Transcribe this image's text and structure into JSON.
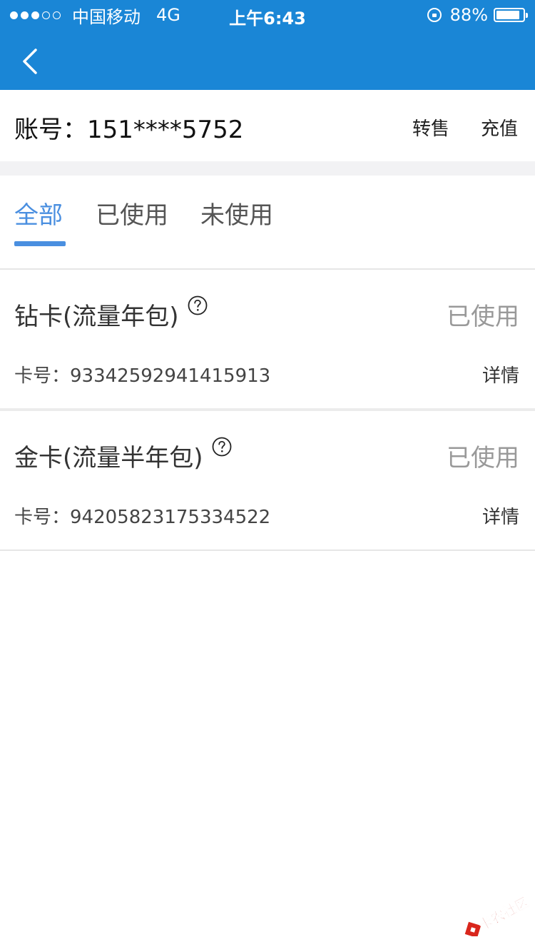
{
  "status_bar": {
    "carrier": "中国移动",
    "network": "4G",
    "time": "上午6:43",
    "battery": "88%",
    "battery_level": 0.88,
    "icons": [
      "signal-dots",
      "orientation-lock-icon",
      "battery-icon"
    ]
  },
  "nav": {
    "back_icon": "chevron-left-icon",
    "bar_color": "#1a86d6"
  },
  "account": {
    "label": "账号：151****5752",
    "transfer": "转售",
    "recharge": "充值"
  },
  "tabs": {
    "items": [
      {
        "label": "全部",
        "active": true
      },
      {
        "label": "已使用",
        "active": false
      },
      {
        "label": "未使用",
        "active": false
      }
    ],
    "active_color": "#4a8fe0"
  },
  "cards": [
    {
      "name": "钻卡(流量年包)",
      "status": "已使用",
      "card_no": "卡号：93342592941415913",
      "detail": "详情"
    },
    {
      "name": "金卡(流量半年包)",
      "status": "已使用",
      "card_no": "卡号：94205823175334522",
      "detail": "详情"
    }
  ],
  "watermark": {
    "text": "卡农社区"
  }
}
